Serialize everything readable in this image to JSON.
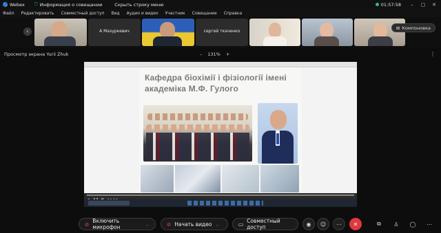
{
  "titlebar": {
    "app_name": "Webex",
    "meeting_info": "Информация о совещании",
    "hide_menu": "Скрыть строку меню",
    "time": "01:57:58"
  },
  "menubar": [
    "Файл",
    "Редактировать",
    "Совместный доступ",
    "Вид",
    "Аудио и видео",
    "Участник",
    "Совещание",
    "Справка"
  ],
  "participants": [
    "А Мазуркевич",
    "сергей ткаченко"
  ],
  "layout_button": "Компоновка",
  "share_view": {
    "label": "Просмотр экрана Yurii Zhuk",
    "zoom": "131%"
  },
  "slide": {
    "title_line1": "Кафедра біохімії і фізіології імені",
    "title_line2": "академіка М.Ф. Гулого"
  },
  "controls": {
    "mic": "Включить микрофон",
    "video": "Начать видео",
    "share": "Совместный доступ"
  },
  "colors": {
    "accent_red": "#f24b4b",
    "background": "#0d0d0d"
  }
}
